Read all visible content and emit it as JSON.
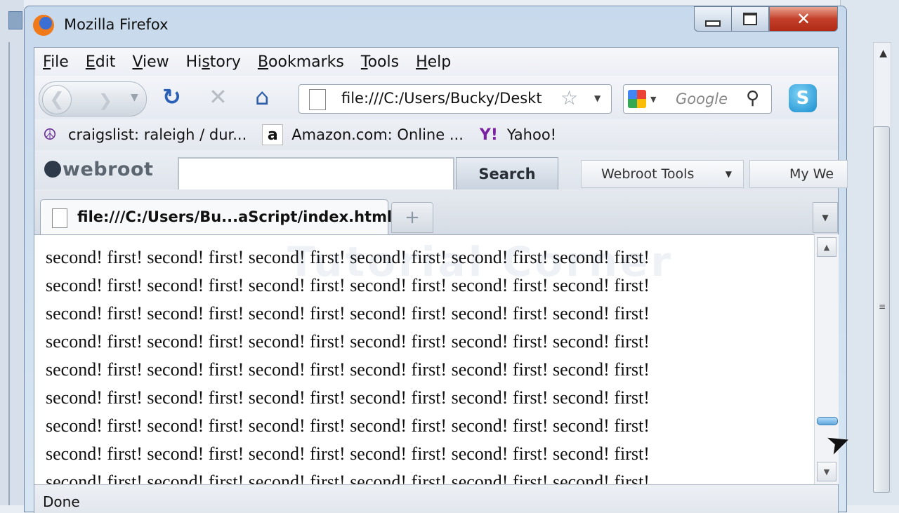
{
  "window": {
    "title": "Mozilla Firefox"
  },
  "menu": [
    {
      "pre": "",
      "u": "F",
      "post": "ile"
    },
    {
      "pre": "",
      "u": "E",
      "post": "dit"
    },
    {
      "pre": "",
      "u": "V",
      "post": "iew"
    },
    {
      "pre": "Hi",
      "u": "s",
      "post": "tory"
    },
    {
      "pre": "",
      "u": "B",
      "post": "ookmarks"
    },
    {
      "pre": "",
      "u": "T",
      "post": "ools"
    },
    {
      "pre": "",
      "u": "H",
      "post": "elp"
    }
  ],
  "navbar": {
    "url": "file:///C:/Users/Bucky/Deskt",
    "search_placeholder": "Google"
  },
  "bookmarks": [
    {
      "label": "craigslist: raleigh / dur...",
      "icon": "peace-icon"
    },
    {
      "label": "Amazon.com: Online ...",
      "icon": "amazon-icon"
    },
    {
      "label": "Yahoo!",
      "icon": "yahoo-icon"
    }
  ],
  "webroot": {
    "logo": "webroot",
    "search_label": "Search",
    "tools_label": "Webroot Tools",
    "myweb_label": "My We"
  },
  "tab": {
    "label": "file:///C:/Users/Bu...aScript/index.html"
  },
  "content": {
    "watermark": "Tutorial Corner",
    "lines": [
      "second! first! second! first! second! first! second! first! second! first! second! first!",
      "second! first! second! first! second! first! second! first! second! first! second! first!",
      "second! first! second! first! second! first! second! first! second! first! second! first!",
      "second! first! second! first! second! first! second! first! second! first! second! first!",
      "second! first! second! first! second! first! second! first! second! first! second! first!",
      "second! first! second! first! second! first! second! first! second! first! second! first!",
      "second! first! second! first! second! first! second! first! second! first! second! first!",
      "second! first! second! first! second! first! second! first! second! first! second! first!",
      "second! first! second! first! second! first! second! first! second! first! second! first!"
    ]
  },
  "status": {
    "text": "Done"
  }
}
